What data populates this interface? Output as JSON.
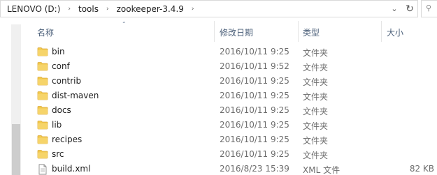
{
  "address": {
    "crumbs": [
      "LENOVO (D:)",
      "tools",
      "zookeeper-3.4.9"
    ],
    "separator": "›",
    "dropdown_glyph": "⌄",
    "refresh_glyph": "↻",
    "search_glyph": "⚲"
  },
  "headers": {
    "name": "名称",
    "modified": "修改日期",
    "type": "类型",
    "size": "大小",
    "sort_glyph": "⌃"
  },
  "rows": [
    {
      "name": "bin",
      "modified": "2016/10/11 9:25",
      "type": "文件夹",
      "size": "",
      "icon": "folder-icon"
    },
    {
      "name": "conf",
      "modified": "2016/10/11 9:52",
      "type": "文件夹",
      "size": "",
      "icon": "folder-icon"
    },
    {
      "name": "contrib",
      "modified": "2016/10/11 9:25",
      "type": "文件夹",
      "size": "",
      "icon": "folder-icon"
    },
    {
      "name": "dist-maven",
      "modified": "2016/10/11 9:25",
      "type": "文件夹",
      "size": "",
      "icon": "folder-icon"
    },
    {
      "name": "docs",
      "modified": "2016/10/11 9:25",
      "type": "文件夹",
      "size": "",
      "icon": "folder-icon"
    },
    {
      "name": "lib",
      "modified": "2016/10/11 9:25",
      "type": "文件夹",
      "size": "",
      "icon": "folder-icon"
    },
    {
      "name": "recipes",
      "modified": "2016/10/11 9:25",
      "type": "文件夹",
      "size": "",
      "icon": "folder-icon"
    },
    {
      "name": "src",
      "modified": "2016/10/11 9:25",
      "type": "文件夹",
      "size": "",
      "icon": "folder-icon"
    },
    {
      "name": "build.xml",
      "modified": "2016/8/23 15:39",
      "type": "XML 文件",
      "size": "82 KB",
      "icon": "xml-file-icon"
    }
  ],
  "colors": {
    "folder": "#f2c94c",
    "folder_dark": "#dca93a",
    "header_text": "#4c607a"
  }
}
